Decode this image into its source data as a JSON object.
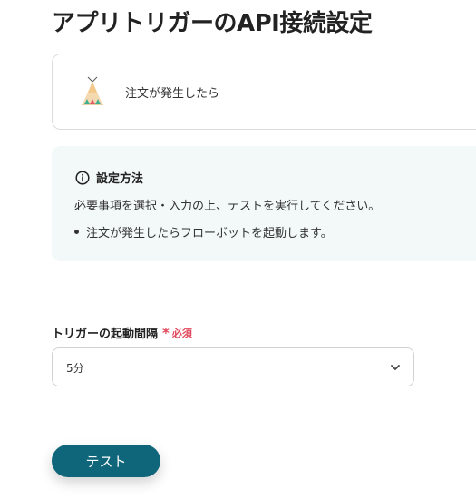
{
  "page": {
    "title": "アプリトリガーのAPI接続設定"
  },
  "trigger": {
    "label": "注文が発生したら",
    "icon": "tent-icon"
  },
  "info": {
    "title": "設定方法",
    "description": "必要事項を選択・入力の上、テストを実行してください。",
    "items": [
      "注文が発生したらフローボットを起動します。"
    ]
  },
  "interval_field": {
    "label": "トリガーの起動間隔",
    "required_mark": "*",
    "required_text": "必須",
    "selected_value": "5分"
  },
  "actions": {
    "test_label": "テスト"
  },
  "colors": {
    "button": "#0f6579",
    "required": "#e0475b",
    "info_bg": "#f2f9f8"
  }
}
